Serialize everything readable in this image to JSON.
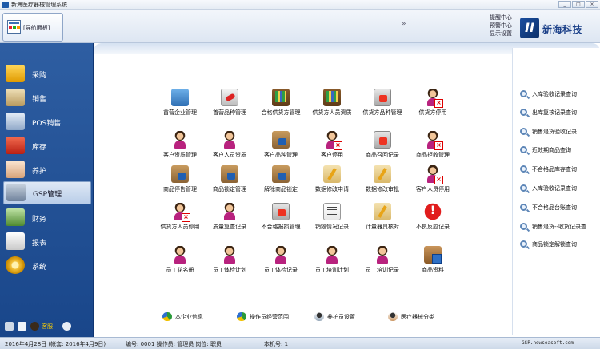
{
  "window": {
    "title": "新海医疗器械管理系统",
    "buttons": [
      "_",
      "□",
      "×"
    ]
  },
  "header": {
    "nav_tab_label": "[导航面板]",
    "expand_glyph": "»",
    "links": [
      "提醒中心",
      "预警中心",
      "显示设置"
    ],
    "brand_logo_glyph": "II",
    "brand_name": "新海科技"
  },
  "sidebar": {
    "items": [
      {
        "label": "采购",
        "icon": "truck-icon",
        "color": "#f4b400"
      },
      {
        "label": "销售",
        "icon": "cart-icon",
        "color": "#d8c08b"
      },
      {
        "label": "POS销售",
        "icon": "pos-icon",
        "color": "#b0c4de"
      },
      {
        "label": "库存",
        "icon": "warehouse-icon",
        "color": "#d83a2a"
      },
      {
        "label": "养护",
        "icon": "nurse-icon",
        "color": "#f0d0b0"
      },
      {
        "label": "GSP管理",
        "icon": "gsp-icon",
        "color": "#7c8ea8",
        "active": true
      },
      {
        "label": "财务",
        "icon": "finance-icon",
        "color": "#6aa84f"
      },
      {
        "label": "报表",
        "icon": "report-icon",
        "color": "#eeeeee"
      },
      {
        "label": "系统",
        "icon": "gear-icon",
        "color": "#f3c13a"
      }
    ],
    "tools": {
      "service_label": "客服"
    }
  },
  "grid": {
    "rows": [
      [
        {
          "label": "首营企业管理",
          "icon": "buildings-icon",
          "style": "buildings"
        },
        {
          "label": "首营品种管理",
          "icon": "pill-icon",
          "style": "pill"
        },
        {
          "label": "合格供货方管理",
          "icon": "shelf-icon",
          "style": "shelf"
        },
        {
          "label": "供货方人员资质",
          "icon": "shelf-icon",
          "style": "shelf"
        },
        {
          "label": "供货方品种管理",
          "icon": "folder-icon",
          "style": "folder"
        },
        {
          "label": "供货方停用",
          "icon": "person-stop-icon",
          "style": "person person-x"
        }
      ],
      [
        {
          "label": "客户资质管理",
          "icon": "person-icon",
          "style": "person"
        },
        {
          "label": "客户人员资质",
          "icon": "person-icon",
          "style": "person"
        },
        {
          "label": "客户品种管理",
          "icon": "lock-icon",
          "style": "lock"
        },
        {
          "label": "客户停用",
          "icon": "person-stop-icon",
          "style": "person person-x"
        },
        {
          "label": "商品召回记录",
          "icon": "recall-icon",
          "style": "folder"
        },
        {
          "label": "商品拒收管理",
          "icon": "person-stop-icon",
          "style": "person person-x"
        }
      ],
      [
        {
          "label": "商品停售管理",
          "icon": "lock-icon",
          "style": "lock"
        },
        {
          "label": "商品锁定管理",
          "icon": "lock-icon",
          "style": "lock"
        },
        {
          "label": "解除商品锁定",
          "icon": "lock-icon",
          "style": "lock"
        },
        {
          "label": "数据修改申请",
          "icon": "edit-icon",
          "style": "pencil"
        },
        {
          "label": "数据修改审批",
          "icon": "edit-icon",
          "style": "pencil"
        },
        {
          "label": "客户人员停用",
          "icon": "person-stop-icon",
          "style": "person person-x"
        }
      ],
      [
        {
          "label": "供货方人员停用",
          "icon": "person-stop-icon",
          "style": "person person-x"
        },
        {
          "label": "质量复查记录",
          "icon": "doctor-icon",
          "style": "person"
        },
        {
          "label": "不合格报损管理",
          "icon": "medical-icon",
          "style": "folder"
        },
        {
          "label": "销毁情况记录",
          "icon": "document-icon",
          "style": "doc"
        },
        {
          "label": "计量器具核对",
          "icon": "edit-icon",
          "style": "pencil"
        },
        {
          "label": "不良反应记录",
          "icon": "warning-icon",
          "style": "warn"
        }
      ],
      [
        {
          "label": "员工花名册",
          "icon": "person-icon",
          "style": "person"
        },
        {
          "label": "员工体检计划",
          "icon": "person-icon",
          "style": "person"
        },
        {
          "label": "员工体检记录",
          "icon": "person-icon",
          "style": "person"
        },
        {
          "label": "员工培训计划",
          "icon": "person-icon",
          "style": "person"
        },
        {
          "label": "员工培训记录",
          "icon": "person-icon",
          "style": "person"
        },
        {
          "label": "商品资料",
          "icon": "box-icon",
          "style": "box"
        }
      ]
    ]
  },
  "bottom_links": [
    {
      "label": "本企业信息",
      "icon": "pie-icon"
    },
    {
      "label": "操作员经营范围",
      "icon": "pie-icon"
    },
    {
      "label": "养护员设置",
      "icon": "user-icon"
    },
    {
      "label": "医疗器械分类",
      "icon": "user-icon"
    }
  ],
  "queries": [
    "入库验收记录查询",
    "出库复核记录查询",
    "销售退货验收记录",
    "近效期商品查询",
    "不合格品库存查询",
    "入库验收记录查询",
    "不合格品台账查询",
    "销售退货--收货记录查",
    "商品锁定解锁查询"
  ],
  "status": {
    "date": "2016年4月28日 (帐套: 2016年4月9日)",
    "operator": "编号: 0001  操作员: 管理员  岗位: 职员",
    "machine": "本机号: 1",
    "site": "GSP.newseasoft.com"
  },
  "colors": {
    "sidebar_bg": "#19468a",
    "brand": "#1a3f88",
    "accent_red": "#e11d1d"
  }
}
